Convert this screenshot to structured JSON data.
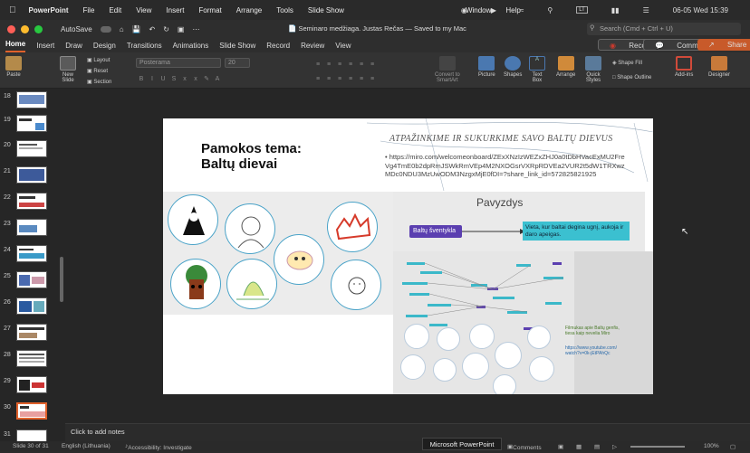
{
  "menubar": {
    "app": "PowerPoint",
    "items": [
      "File",
      "Edit",
      "View",
      "Insert",
      "Format",
      "Arrange",
      "Tools",
      "Slide Show",
      "Window",
      "Help"
    ],
    "lang": "LT",
    "datetime": "06-05 Wed  15:39"
  },
  "titlebar": {
    "autosave": "AutoSave",
    "doc_title": "Seminaro medžiaga. Justas Rečas — Saved to my Mac",
    "search_placeholder": "Search (Cmd + Ctrl + U)"
  },
  "ribbon_tabs": [
    "Home",
    "Insert",
    "Draw",
    "Design",
    "Transitions",
    "Animations",
    "Slide Show",
    "Record",
    "Review",
    "View"
  ],
  "ribbon_buttons": {
    "record": "Record",
    "comments": "Comments",
    "share": "Share"
  },
  "ribbon": {
    "paste": "Paste",
    "new_slide": "New\nSlide",
    "layout": "Layout",
    "reset": "Reset",
    "section": "Section",
    "font_placeholder": "Posterama",
    "font_size": "20",
    "convert": "Convert to\nSmartArt",
    "picture": "Picture",
    "shapes": "Shapes",
    "textbox": "Text\nBox",
    "arrange": "Arrange",
    "quick_styles": "Quick\nStyles",
    "shape_fill": "Shape Fill",
    "shape_outline": "Shape Outline",
    "addins": "Add-ins",
    "designer": "Designer"
  },
  "thumbnails": [
    18,
    19,
    20,
    21,
    22,
    23,
    24,
    25,
    26,
    27,
    28,
    29,
    30,
    31
  ],
  "selected_slide": 30,
  "slide": {
    "title": "Pamokos tema:\nBaltų dievai",
    "heading": "ATPAŽINKIME IR SUKURKIME SAVO BALTŲ DIEVUS",
    "link": "https://miro.com/welcomeonboard/ZExXNzIzWEZxZHJ0a0tDbHVacExMU2FreVg4TmE0b2dpRmJSWkRmVEp4M2NXOGsrVXRpRDVEa2VUR2t5dW1TRXwzMDc0NDU3MzUwODM3NzgxMjE0fDI=?share_link_id=572825821925",
    "pavyzdys": "Pavyzdys",
    "tag": "Baltų šventykla",
    "tag_desc": "Vieta, kur baltai degina ugnį, aukoja ir daro apeigas.",
    "mini_link1": "Filmukas apie Baltų genfis, tiesa kaip nevelia Miro",
    "mini_link2": "https://www.youtube.com/watch?v=0k-jEtPAhQc"
  },
  "notes_placeholder": "Click to add notes",
  "status": {
    "slide": "Slide 30 of 31",
    "lang": "English (Lithuania)",
    "accessibility": "Accessibility: Investigate",
    "comments": "Comments",
    "zoom": "100%"
  },
  "tooltip": "Microsoft PowerPoint",
  "colors": {
    "accent": "#e0612b",
    "record": "#c93a2e",
    "share": "#c85a2a",
    "tag_purple": "#5b3fb0",
    "tag_cyan": "#3bc0d0"
  }
}
